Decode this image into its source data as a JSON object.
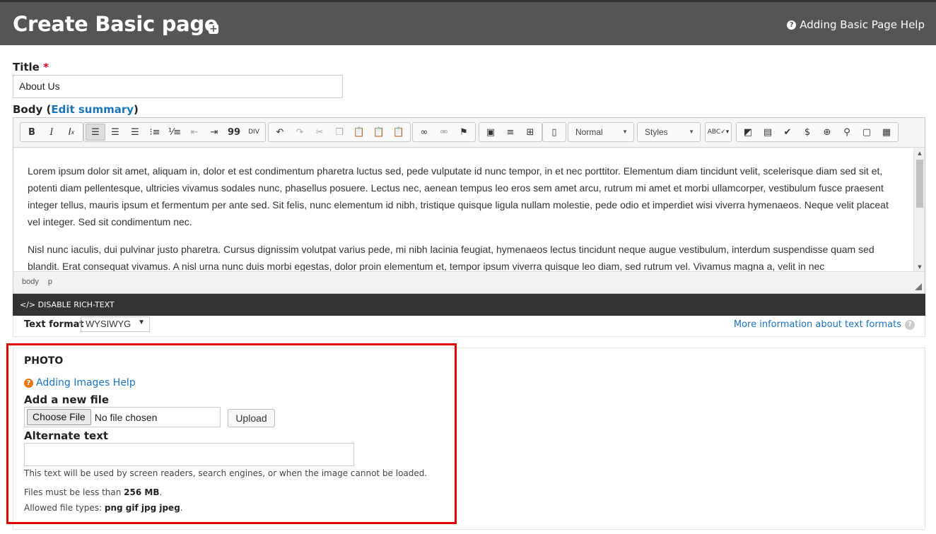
{
  "header": {
    "title": "Create Basic page",
    "help_label": "Adding Basic Page Help"
  },
  "title_field": {
    "label": "Title",
    "required_mark": "*",
    "value": "About Us"
  },
  "body_field": {
    "label": "Body",
    "edit_summary_link": "Edit summary",
    "paren_open": "(",
    "paren_close": ")"
  },
  "toolbar": {
    "format_select": "Normal",
    "styles_select": "Styles",
    "buttons": [
      "bold",
      "italic",
      "remove-format",
      "align-left",
      "align-center",
      "align-right",
      "bulleted-list",
      "numbered-list",
      "outdent",
      "indent",
      "blockquote",
      "div",
      "undo",
      "redo",
      "cut",
      "copy",
      "paste",
      "paste-text",
      "paste-word",
      "link",
      "unlink",
      "anchor",
      "image",
      "horizontal-rule",
      "table",
      "show-blocks",
      "spellcheck",
      "media-embed",
      "iframe",
      "check",
      "dollar",
      "plus",
      "map-marker",
      "square",
      "film"
    ]
  },
  "editor": {
    "paragraphs": [
      "Lorem ipsum dolor sit amet, aliquam in, dolor et est condimentum pharetra luctus sed, pede vulputate id nunc tempor, in et nec porttitor. Elementum diam tincidunt velit, scelerisque diam sed sit et, potenti diam pellentesque, ultricies vivamus sodales nunc, phasellus posuere. Lectus nec, aenean tempus leo eros sem amet arcu, rutrum mi amet et morbi ullamcorper, vestibulum fusce praesent integer tellus, mauris ipsum et fermentum per ante sed. Sit felis, nunc elementum id nibh, tristique quisque ligula nullam molestie, pede odio et imperdiet wisi viverra hymenaeos. Neque velit placeat vel integer. Sed sit condimentum nec.",
      "Nisl nunc iaculis, dui pulvinar justo pharetra. Cursus dignissim volutpat varius pede, mi nibh lacinia feugiat, hymenaeos lectus tincidunt neque augue vestibulum, interdum suspendisse quam sed blandit. Erat consequat vivamus. A nisl urna nunc duis morbi egestas, dolor proin elementum et, tempor ipsum viverra quisque leo diam, sed rutrum vel. Vivamus magna a, velit in nec"
    ],
    "path": [
      "body",
      "p"
    ]
  },
  "disable_rich_text": "DISABLE RICH-TEXT",
  "text_format": {
    "label": "Text format",
    "value": "WYSIWYG",
    "more_info": "More information about text formats"
  },
  "photo": {
    "section_title": "PHOTO",
    "help_link": "Adding Images Help",
    "add_file_label": "Add a new file",
    "choose_file": "Choose File",
    "no_file": "No file chosen",
    "upload": "Upload",
    "alt_label": "Alternate text",
    "alt_value": "",
    "alt_desc": "This text will be used by screen readers, search engines, or when the image cannot be loaded.",
    "size_prefix": "Files must be less than",
    "size_value": "256 MB",
    "types_prefix": "Allowed file types:",
    "types_value": "png gif jpg jpeg"
  },
  "colors": {
    "header_bg": "#555555",
    "link": "#1a74b8",
    "required": "#d0021b",
    "highlight": "#e00000",
    "disable_bar": "#333333"
  }
}
